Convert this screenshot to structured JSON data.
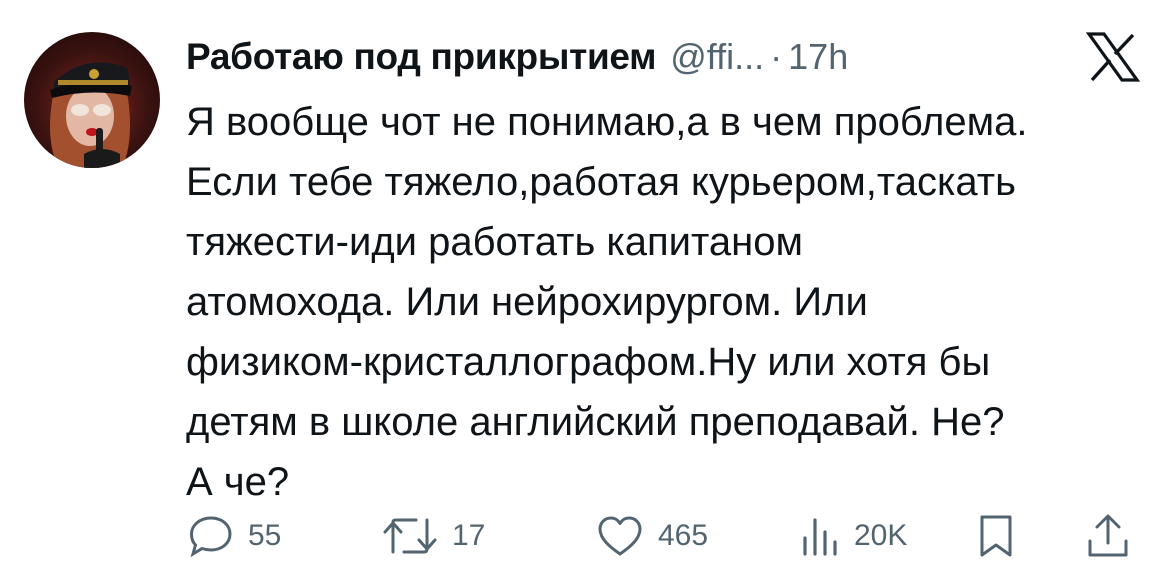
{
  "author": {
    "display_name": "Работаю под прикрытием",
    "handle": "@ffi...",
    "separator": "·",
    "time": "17h",
    "avatar_icon": "avatar-photo"
  },
  "platform_icon": "x-logo-icon",
  "tweet": {
    "text": "Я вообще чот не понимаю,а в чем проблема.\nЕсли тебе тяжело,работая курьером,таскать\nтяжести-иди работать капитаном\nатомохода. Или нейрохирургом. Или\nфизиком-кристаллографом.Ну или хотя бы\nдетям в школе английский преподавай. Не?\nА че?"
  },
  "actions": {
    "reply": {
      "icon": "reply-icon",
      "count": "55"
    },
    "retweet": {
      "icon": "retweet-icon",
      "count": "17"
    },
    "like": {
      "icon": "heart-icon",
      "count": "465"
    },
    "views": {
      "icon": "views-icon",
      "count": "20K"
    },
    "bookmark": {
      "icon": "bookmark-icon"
    },
    "share": {
      "icon": "share-icon"
    }
  },
  "colors": {
    "text_primary": "#0f1419",
    "text_secondary": "#536471",
    "background": "#ffffff"
  }
}
